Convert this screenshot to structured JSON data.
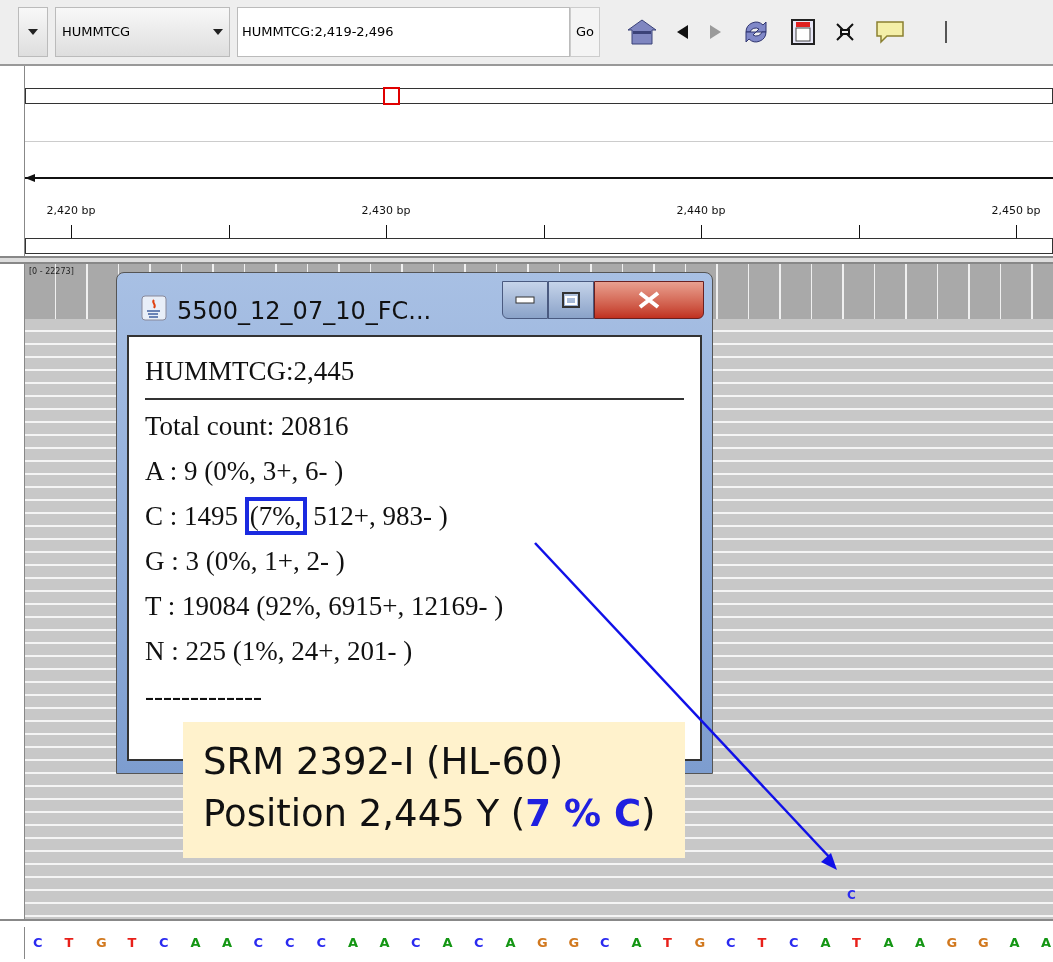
{
  "toolbar": {
    "genome_dropdown": "HUMMTCG",
    "locus_field": "HUMMTCG:2,419-2,496",
    "go_button": "Go",
    "forward_disabled": true
  },
  "ruler": {
    "labels": [
      "2,420 bp",
      "2,430 bp",
      "2,440 bp",
      "2,450 bp"
    ]
  },
  "coverage_track": {
    "range": "[0 - 22273]"
  },
  "popup": {
    "title": "5500_12_07_10_FC...",
    "heading": "HUMMTCG:2,445",
    "lines": [
      {
        "text": "Total count: 20816"
      },
      {
        "text": "A : 9 (0%, 3+, 6- )"
      },
      {
        "text": "C : 1495 ",
        "boxed": "(7%,",
        "rest": " 512+, 983- )"
      },
      {
        "text": "G : 3 (0%, 1+, 2- )"
      },
      {
        "text": "T : 19084 (92%, 6915+, 12169- )"
      },
      {
        "text": "N : 225 (1%, 24+, 201- )"
      },
      {
        "text": "-------------"
      }
    ]
  },
  "callout": {
    "lines": [
      "SRM 2392-I (HL-60)",
      "Position 2,445 Y (**7 % C**)"
    ]
  },
  "variant_base": {
    "base": "C",
    "color": "#2a2af0"
  },
  "sequence": [
    {
      "base": "C",
      "color": "#2a2af0"
    },
    {
      "base": "T",
      "color": "#e8201a"
    },
    {
      "base": "G",
      "color": "#d1781e"
    },
    {
      "base": "T",
      "color": "#e8201a"
    },
    {
      "base": "C",
      "color": "#2a2af0"
    },
    {
      "base": "A",
      "color": "#149614"
    },
    {
      "base": "A",
      "color": "#149614"
    },
    {
      "base": "C",
      "color": "#2a2af0"
    },
    {
      "base": "C",
      "color": "#2a2af0"
    },
    {
      "base": "C",
      "color": "#2a2af0"
    },
    {
      "base": "A",
      "color": "#149614"
    },
    {
      "base": "A",
      "color": "#149614"
    },
    {
      "base": "C",
      "color": "#2a2af0"
    },
    {
      "base": "A",
      "color": "#149614"
    },
    {
      "base": "C",
      "color": "#2a2af0"
    },
    {
      "base": "A",
      "color": "#149614"
    },
    {
      "base": "G",
      "color": "#d1781e"
    },
    {
      "base": "G",
      "color": "#d1781e"
    },
    {
      "base": "C",
      "color": "#2a2af0"
    },
    {
      "base": "A",
      "color": "#149614"
    },
    {
      "base": "T",
      "color": "#e8201a"
    },
    {
      "base": "G",
      "color": "#d1781e"
    },
    {
      "base": "C",
      "color": "#2a2af0"
    },
    {
      "base": "T",
      "color": "#e8201a"
    },
    {
      "base": "C",
      "color": "#2a2af0"
    },
    {
      "base": "A",
      "color": "#149614"
    },
    {
      "base": "T",
      "color": "#e8201a"
    },
    {
      "base": "A",
      "color": "#149614"
    },
    {
      "base": "A",
      "color": "#149614"
    },
    {
      "base": "G",
      "color": "#d1781e"
    },
    {
      "base": "G",
      "color": "#d1781e"
    },
    {
      "base": "A",
      "color": "#149614"
    },
    {
      "base": "A",
      "color": "#149614"
    }
  ]
}
